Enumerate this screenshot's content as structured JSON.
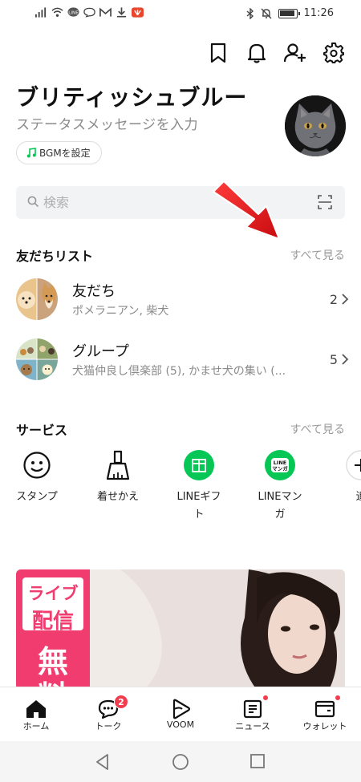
{
  "status_bar": {
    "time": "11:26"
  },
  "header": {
    "icons": [
      "bookmark-icon",
      "bell-icon",
      "add-friend-icon",
      "settings-icon"
    ]
  },
  "profile": {
    "name": "ブリティッシュブルー",
    "status_message": "ステータスメッセージを入力",
    "bgm_label": "BGMを設定"
  },
  "search": {
    "placeholder": "検索"
  },
  "friends_section": {
    "title": "友だちリスト",
    "see_all": "すべて見る",
    "rows": [
      {
        "title": "友だち",
        "subtitle": "ポメラニアン, 柴犬",
        "count": "2"
      },
      {
        "title": "グループ",
        "subtitle": "犬猫仲良し倶楽部 (5), かませ犬の集い (...",
        "count": "5"
      }
    ]
  },
  "services_section": {
    "title": "サービス",
    "see_all": "すべて見る",
    "items": [
      {
        "label": "スタンプ",
        "icon": "smiley-icon"
      },
      {
        "label": "着せかえ",
        "icon": "brush-icon"
      },
      {
        "label": "LINEギフト",
        "icon": "gift-icon"
      },
      {
        "label": "LINEマンガ",
        "icon": "line-manga-icon",
        "icon_text": "LINE\nマンガ"
      },
      {
        "label": "追",
        "icon": "add-icon"
      }
    ]
  },
  "banner": {
    "tag1": "ライブ",
    "tag2": "配信",
    "tag3": "無",
    "tag4": "料"
  },
  "bottom_nav": [
    {
      "label": "ホーム",
      "icon": "home-icon",
      "active": true
    },
    {
      "label": "トーク",
      "icon": "chat-icon",
      "badge": "2"
    },
    {
      "label": "VOOM",
      "icon": "voom-icon"
    },
    {
      "label": "ニュース",
      "icon": "news-icon",
      "dot": true
    },
    {
      "label": "ウォレット",
      "icon": "wallet-icon",
      "dot": true
    }
  ],
  "colors": {
    "line_green": "#06c755",
    "badge_red": "#f23b4c",
    "banner_pink": "#f03c6e",
    "arrow_red": "#e8151b"
  }
}
